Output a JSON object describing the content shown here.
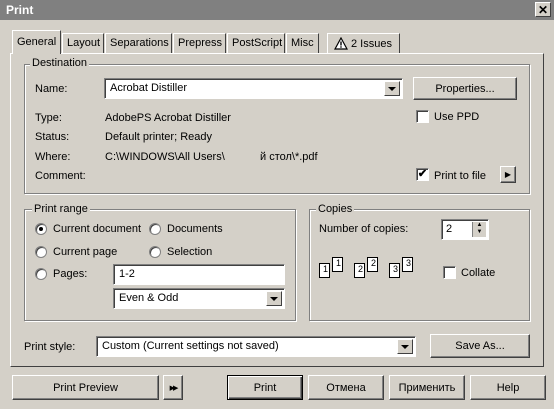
{
  "window": {
    "title": "Print",
    "close_glyph": "✕"
  },
  "tabs": [
    {
      "label": "General"
    },
    {
      "label": "Layout"
    },
    {
      "label": "Separations"
    },
    {
      "label": "Prepress"
    },
    {
      "label": "PostScript"
    },
    {
      "label": "Misc"
    },
    {
      "label": "2 Issues"
    }
  ],
  "destination": {
    "legend": "Destination",
    "name_label": "Name:",
    "name_value": "Acrobat Distiller",
    "properties_button": "Properties...",
    "type_label": "Type:",
    "type_value": "AdobePS Acrobat Distiller",
    "status_label": "Status:",
    "status_value": "Default printer; Ready",
    "where_label": "Where:",
    "where_value_a": "C:\\WINDOWS\\All Users\\",
    "where_value_b": "й стол\\*.pdf",
    "comment_label": "Comment:",
    "use_ppd_label": "Use PPD",
    "use_ppd_checked": false,
    "print_to_file_label": "Print to file",
    "print_to_file_checked": true,
    "check_glyph": "✔",
    "arrow_glyph": "▶"
  },
  "print_range": {
    "legend": "Print range",
    "current_document": "Current document",
    "documents": "Documents",
    "current_page": "Current page",
    "selection": "Selection",
    "pages_label": "Pages:",
    "pages_value": "1-2",
    "subset_value": "Even & Odd",
    "selected": "current_document"
  },
  "copies": {
    "legend": "Copies",
    "number_label": "Number of copies:",
    "number_value": "2",
    "collate_label": "Collate",
    "collate_checked": false,
    "page_numbers": [
      "1",
      "1",
      "2",
      "2",
      "3",
      "3"
    ]
  },
  "print_style": {
    "label": "Print style:",
    "value": "Custom (Current settings not saved)",
    "save_as_button": "Save As..."
  },
  "footer": {
    "print_preview": "Print Preview",
    "expand_glyph": "▶▶",
    "print": "Print",
    "cancel": "Отмена",
    "apply": "Применить",
    "help": "Help"
  }
}
